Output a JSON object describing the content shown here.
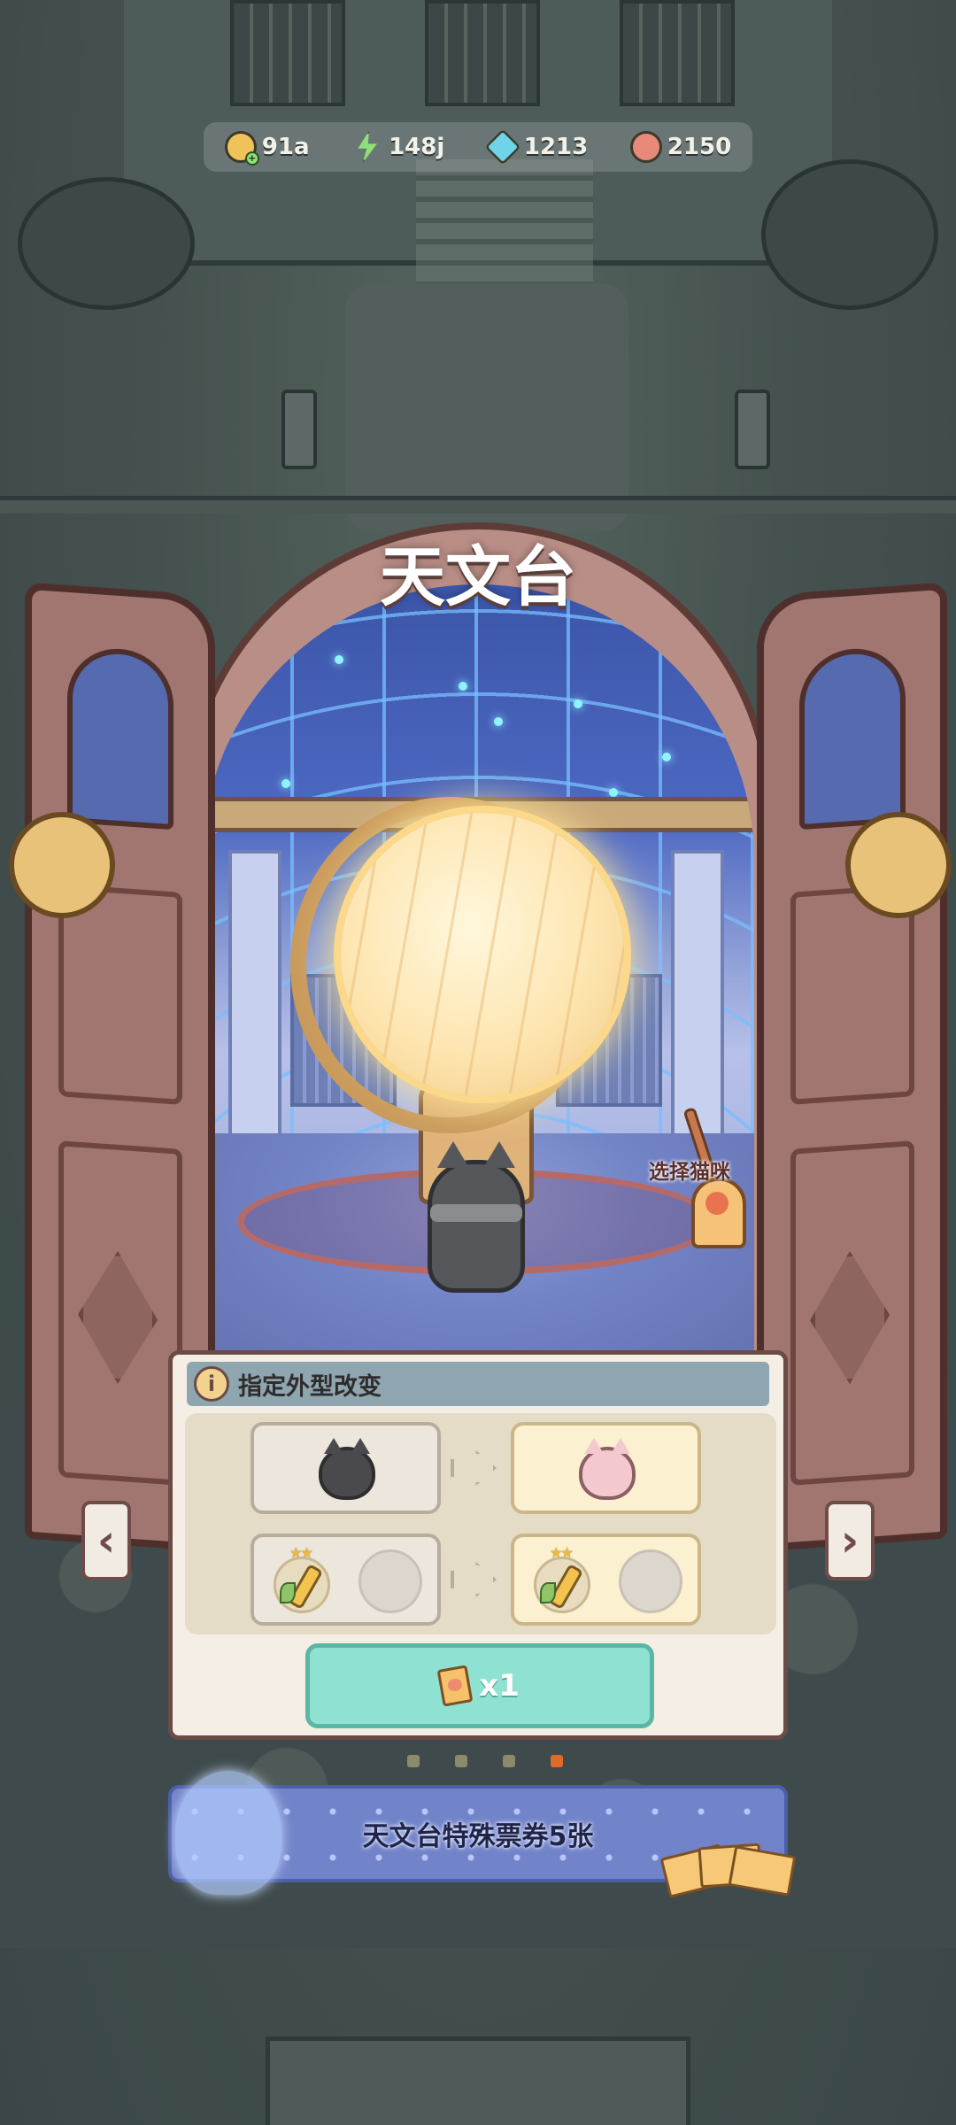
{
  "currencies": [
    {
      "name": "coin",
      "icon": "coin-icon",
      "value": "91a",
      "color": "#f0c25a"
    },
    {
      "name": "energy",
      "icon": "lightning-icon",
      "value": "148j",
      "color": "#8fe07a"
    },
    {
      "name": "gem",
      "icon": "gem-icon",
      "value": "1213",
      "color": "#6fd3ea"
    },
    {
      "name": "shell",
      "icon": "shell-icon",
      "value": "2150",
      "color": "#e88a7a"
    }
  ],
  "screen": {
    "title": "天文台",
    "select_cat_label": "选择猫咪"
  },
  "panel": {
    "header_label": "指定外型改变",
    "info_glyph": "i",
    "action_count": "x1"
  },
  "pagination": {
    "count": 4,
    "active_index": 3
  },
  "banner": {
    "label": "天文台特殊票券5张"
  },
  "nav": {
    "prev_glyph": "‹",
    "next_glyph": "›"
  },
  "stars_glyph": "★★"
}
